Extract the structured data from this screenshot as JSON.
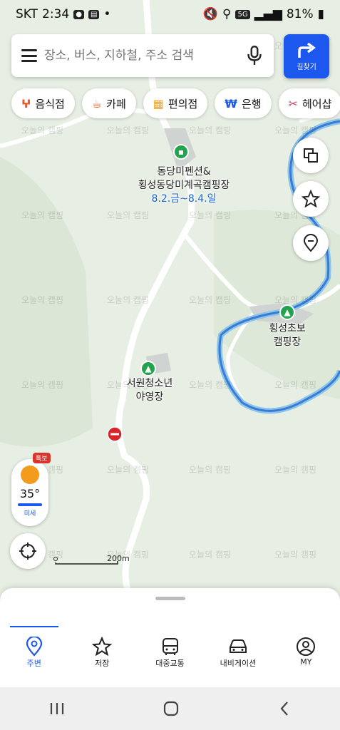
{
  "status_bar": {
    "carrier": "SKT",
    "time": "2:34",
    "battery": "81%",
    "network": "5G"
  },
  "search": {
    "placeholder": "장소, 버스, 지하철, 주소 검색"
  },
  "directions_button": {
    "label": "길찾기"
  },
  "categories": [
    {
      "label": "음식점",
      "icon": "fork-knife-icon",
      "color": "#e85a2a"
    },
    {
      "label": "카페",
      "icon": "coffee-icon",
      "color": "#e85a2a"
    },
    {
      "label": "편의점",
      "icon": "store-icon",
      "color": "#f3a21b"
    },
    {
      "label": "은행",
      "icon": "won-icon",
      "color": "#1c57ee"
    },
    {
      "label": "헤어샵",
      "icon": "scissors-icon",
      "color": "#d33a6a"
    }
  ],
  "map": {
    "places": [
      {
        "name_line1": "동당미펜션&",
        "name_line2": "횡성동당미계곡캠핑장",
        "date": "8.2.금~8.4.일"
      },
      {
        "name_line1": "횡성초보",
        "name_line2": "캠핑장"
      },
      {
        "name_line1": "서원청소년",
        "name_line2": "야영장"
      }
    ],
    "watermark": "오늘의 캠핑",
    "scale_label": "200m",
    "colors": {
      "road": "#ffffff",
      "river": "#3b79d8",
      "river_edge": "#8bc6e8",
      "land": "#e7eee3",
      "forest": "#d7e3d2"
    }
  },
  "weather": {
    "badge": "특보",
    "temperature": "35°",
    "dust": "미세"
  },
  "tabs": [
    {
      "label": "주변",
      "icon": "location-pin-icon",
      "active": true
    },
    {
      "label": "저장",
      "icon": "star-icon"
    },
    {
      "label": "대중교통",
      "icon": "bus-icon"
    },
    {
      "label": "내비게이션",
      "icon": "car-icon"
    },
    {
      "label": "MY",
      "icon": "profile-icon"
    }
  ]
}
